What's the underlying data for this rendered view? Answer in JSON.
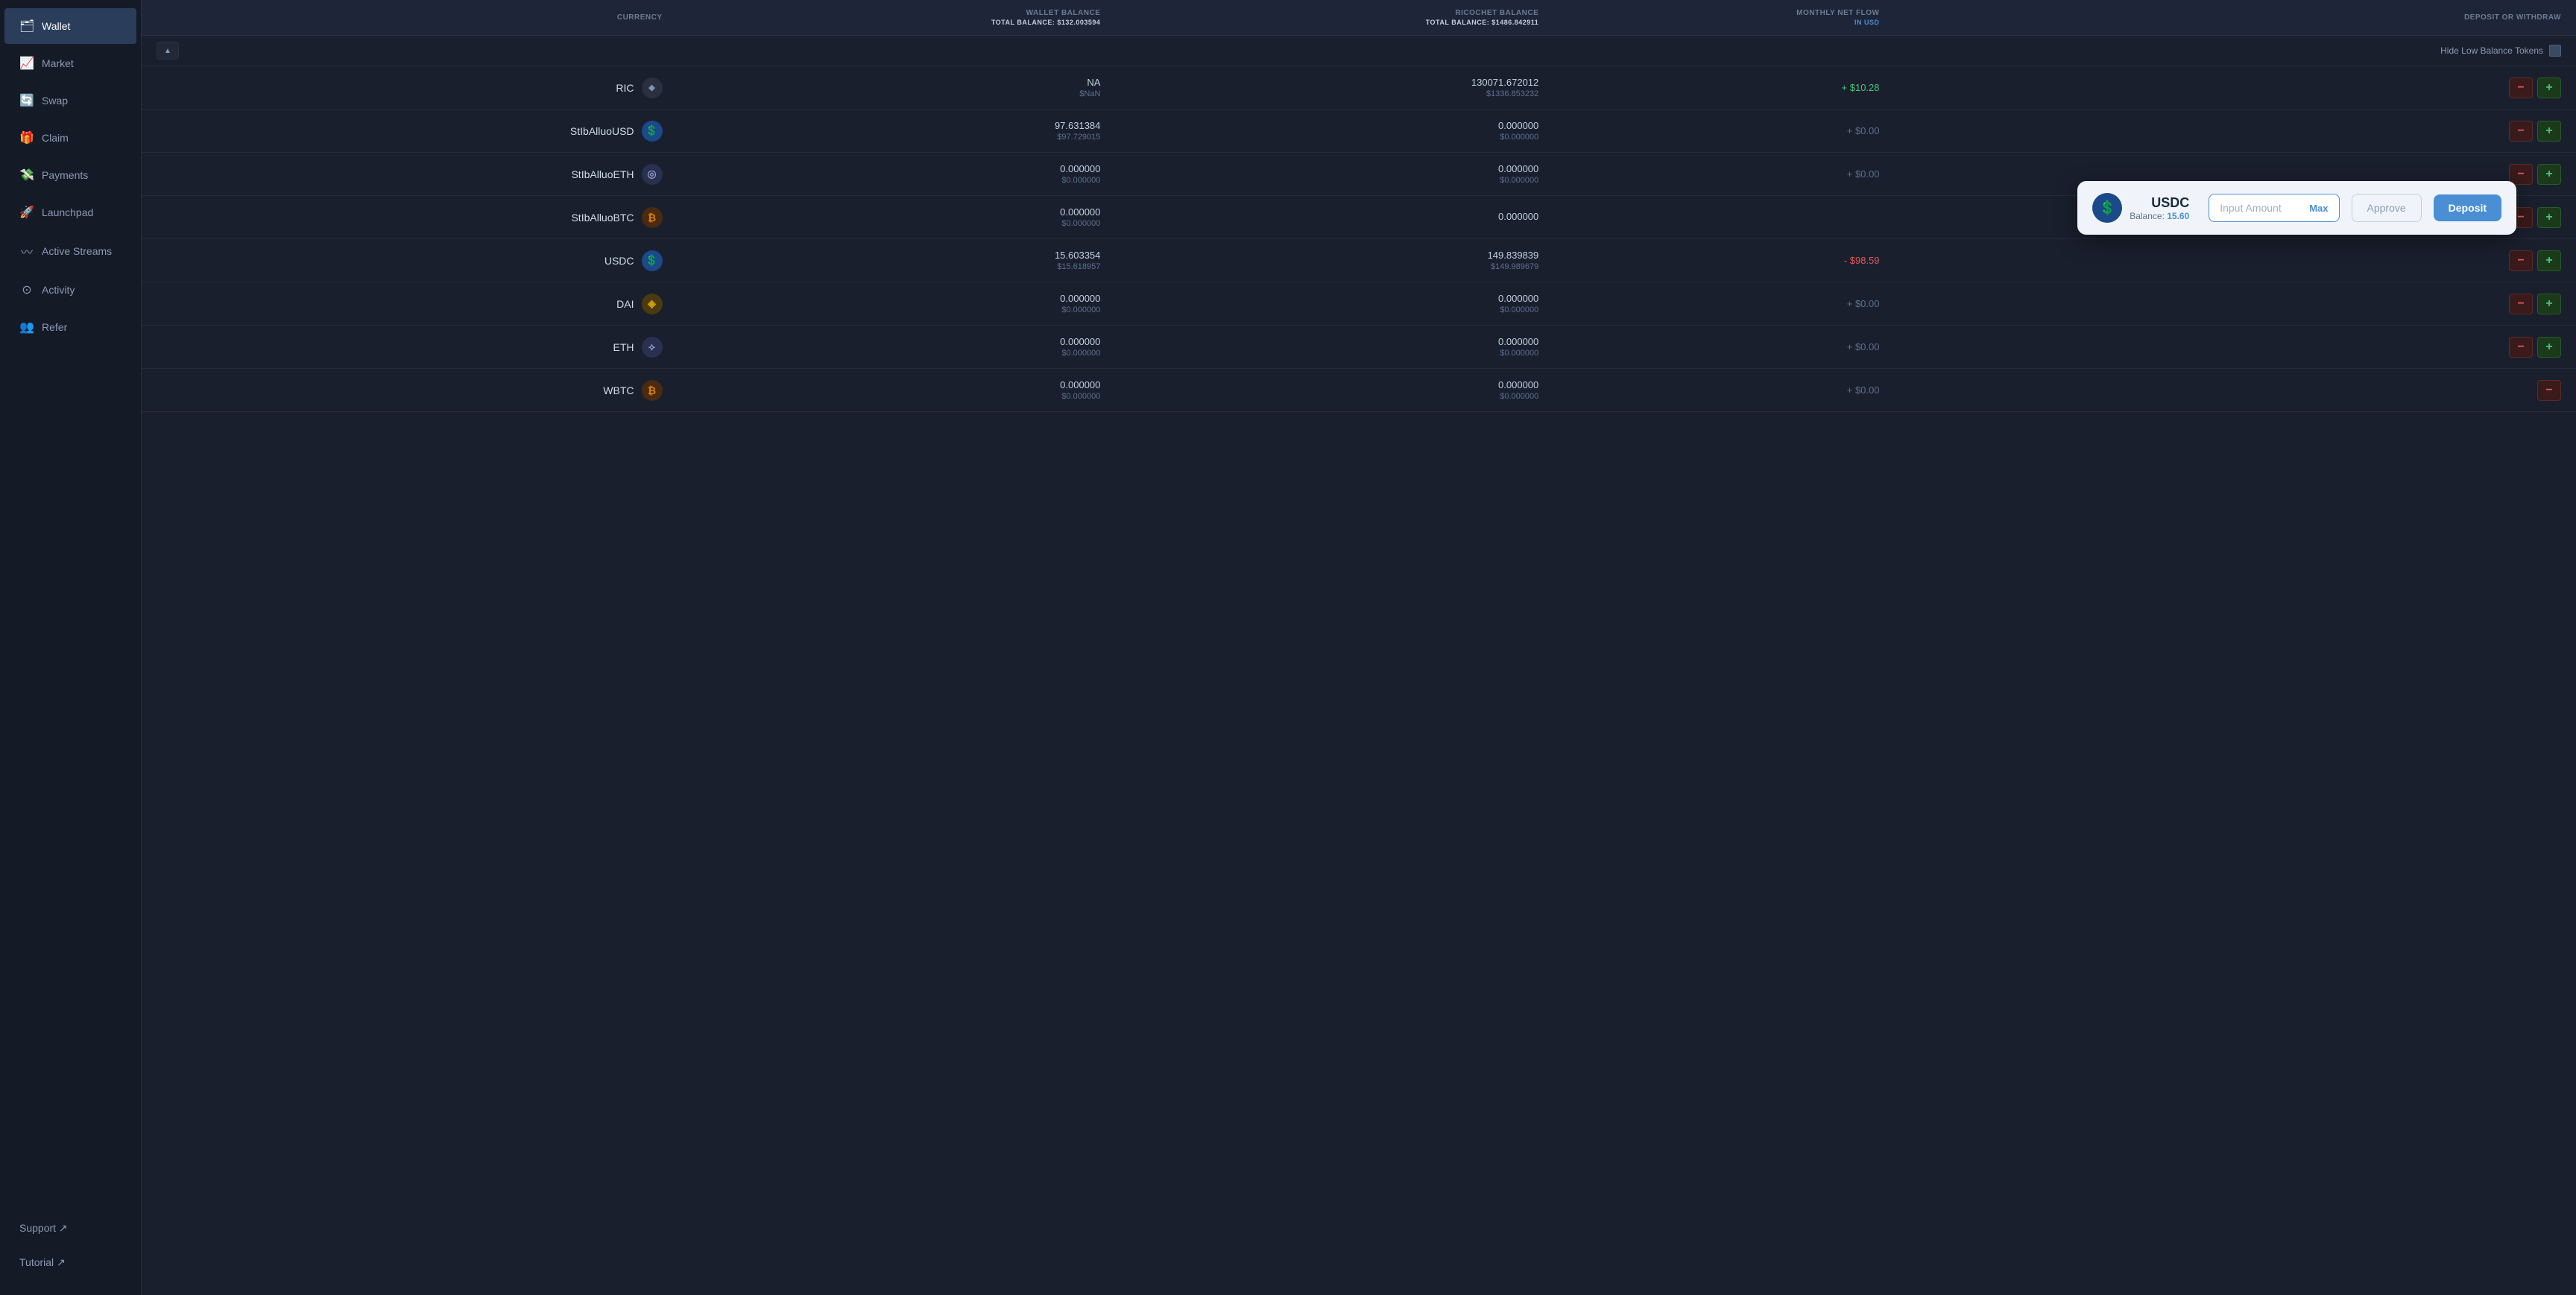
{
  "sidebar": {
    "items": [
      {
        "id": "wallet",
        "label": "Wallet",
        "icon": "🗂",
        "active": true
      },
      {
        "id": "market",
        "label": "Market",
        "icon": "📈",
        "active": false
      },
      {
        "id": "swap",
        "label": "Swap",
        "icon": "🔄",
        "active": false
      },
      {
        "id": "claim",
        "label": "Claim",
        "icon": "🎁",
        "active": false
      },
      {
        "id": "payments",
        "label": "Payments",
        "icon": "💸",
        "active": false
      },
      {
        "id": "launchpad",
        "label": "Launchpad",
        "icon": "🚀",
        "active": false
      },
      {
        "id": "active-streams",
        "label": "Active Streams",
        "icon": "〰",
        "active": false
      },
      {
        "id": "activity",
        "label": "Activity",
        "icon": "⊙",
        "active": false
      },
      {
        "id": "refer",
        "label": "Refer",
        "icon": "👥",
        "active": false
      }
    ],
    "bottom": [
      {
        "id": "support",
        "label": "Support ↗",
        "icon": ""
      },
      {
        "id": "tutorial",
        "label": "Tutorial ↗",
        "icon": ""
      }
    ]
  },
  "table": {
    "headers": {
      "currency": "CURRENCY",
      "wallet_balance": "WALLET BALANCE",
      "wallet_total": "TOTAL BALANCE: $132.003594",
      "ricochet_balance": "RICOCHET BALANCE",
      "ricochet_total": "TOTAL BALANCE: $1486.842911",
      "monthly_net_flow": "MONTHLY NET FLOW",
      "monthly_in": "IN USD",
      "deposit_or_withdraw": "DEPOSIT OR WITHDRAW"
    },
    "hide_low_balance_label": "Hide Low Balance Tokens",
    "rows": [
      {
        "id": "ric",
        "icon": "◈",
        "icon_class": "icon-ric",
        "name": "RIC",
        "wallet_main": "NA",
        "wallet_sub": "$NaN",
        "ricochet_main": "130071.672012",
        "ricochet_sub": "$1336.853232",
        "flow": "+ $10.28",
        "flow_class": "flow-pos",
        "has_minus": true,
        "has_plus": true,
        "minus_gray": false,
        "plus_gray": false
      },
      {
        "id": "stIbAlluoUSD",
        "icon": "💲",
        "icon_class": "icon-usd",
        "name": "StIbAlluoUSD",
        "wallet_main": "97.631384",
        "wallet_sub": "$97.729015",
        "ricochet_main": "0.000000",
        "ricochet_sub": "$0.000000",
        "flow": "+ $0.00",
        "flow_class": "flow-zero",
        "has_minus": true,
        "has_plus": true,
        "minus_gray": false,
        "plus_gray": false
      },
      {
        "id": "stIbAlluoETH",
        "icon": "◎",
        "icon_class": "icon-eth",
        "name": "StIbAlluoETH",
        "wallet_main": "0.000000",
        "wallet_sub": "$0.000000",
        "ricochet_main": "0.000000",
        "ricochet_sub": "$0.000000",
        "flow": "+ $0.00",
        "flow_class": "flow-zero",
        "has_minus": true,
        "has_plus": true,
        "minus_gray": false,
        "plus_gray": false
      },
      {
        "id": "stIbAlluoBTC",
        "icon": "₿",
        "icon_class": "icon-btc",
        "name": "StIbAlluoBTC",
        "wallet_main": "0.000000",
        "wallet_sub": "$0.000000",
        "ricochet_main": "0.000000",
        "ricochet_sub": "",
        "flow": "",
        "flow_class": "flow-zero",
        "has_minus": true,
        "has_plus": true,
        "minus_gray": false,
        "plus_gray": false,
        "has_popup": true
      },
      {
        "id": "usdc",
        "icon": "💲",
        "icon_class": "icon-usdc",
        "name": "USDC",
        "wallet_main": "15.603354",
        "wallet_sub": "$15.618957",
        "ricochet_main": "149.839839",
        "ricochet_sub": "$149.989679",
        "flow": "- $98.59",
        "flow_class": "flow-neg",
        "has_minus": true,
        "has_plus": true,
        "minus_gray": false,
        "plus_gray": false
      },
      {
        "id": "dai",
        "icon": "◈",
        "icon_class": "icon-dai",
        "name": "DAI",
        "wallet_main": "0.000000",
        "wallet_sub": "$0.000000",
        "ricochet_main": "0.000000",
        "ricochet_sub": "$0.000000",
        "flow": "+ $0.00",
        "flow_class": "flow-zero",
        "has_minus": true,
        "has_plus": true,
        "minus_gray": false,
        "plus_gray": false
      },
      {
        "id": "eth",
        "icon": "⟡",
        "icon_class": "icon-eth",
        "name": "ETH",
        "wallet_main": "0.000000",
        "wallet_sub": "$0.000000",
        "ricochet_main": "0.000000",
        "ricochet_sub": "$0.000000",
        "flow": "+ $0.00",
        "flow_class": "flow-zero",
        "has_minus": true,
        "has_plus": true,
        "minus_gray": false,
        "plus_gray": false
      },
      {
        "id": "wbtc",
        "icon": "₿",
        "icon_class": "icon-wbtc",
        "name": "WBTC",
        "wallet_main": "0.000000",
        "wallet_sub": "$0.000000",
        "ricochet_main": "0.000000",
        "ricochet_sub": "$0.000000",
        "flow": "+ $0.00",
        "flow_class": "flow-zero",
        "has_minus": true,
        "has_plus": false,
        "minus_gray": false,
        "plus_gray": false
      }
    ]
  },
  "popup": {
    "currency": "USDC",
    "balance_label": "Balance:",
    "balance_value": "15.60",
    "input_placeholder": "Input Amount",
    "max_label": "Max",
    "approve_label": "Approve",
    "deposit_label": "Deposit"
  },
  "colors": {
    "accent_blue": "#4a8fd4",
    "positive": "#4ac47a",
    "negative": "#e05a5a",
    "sidebar_active": "#2a3d5a"
  }
}
